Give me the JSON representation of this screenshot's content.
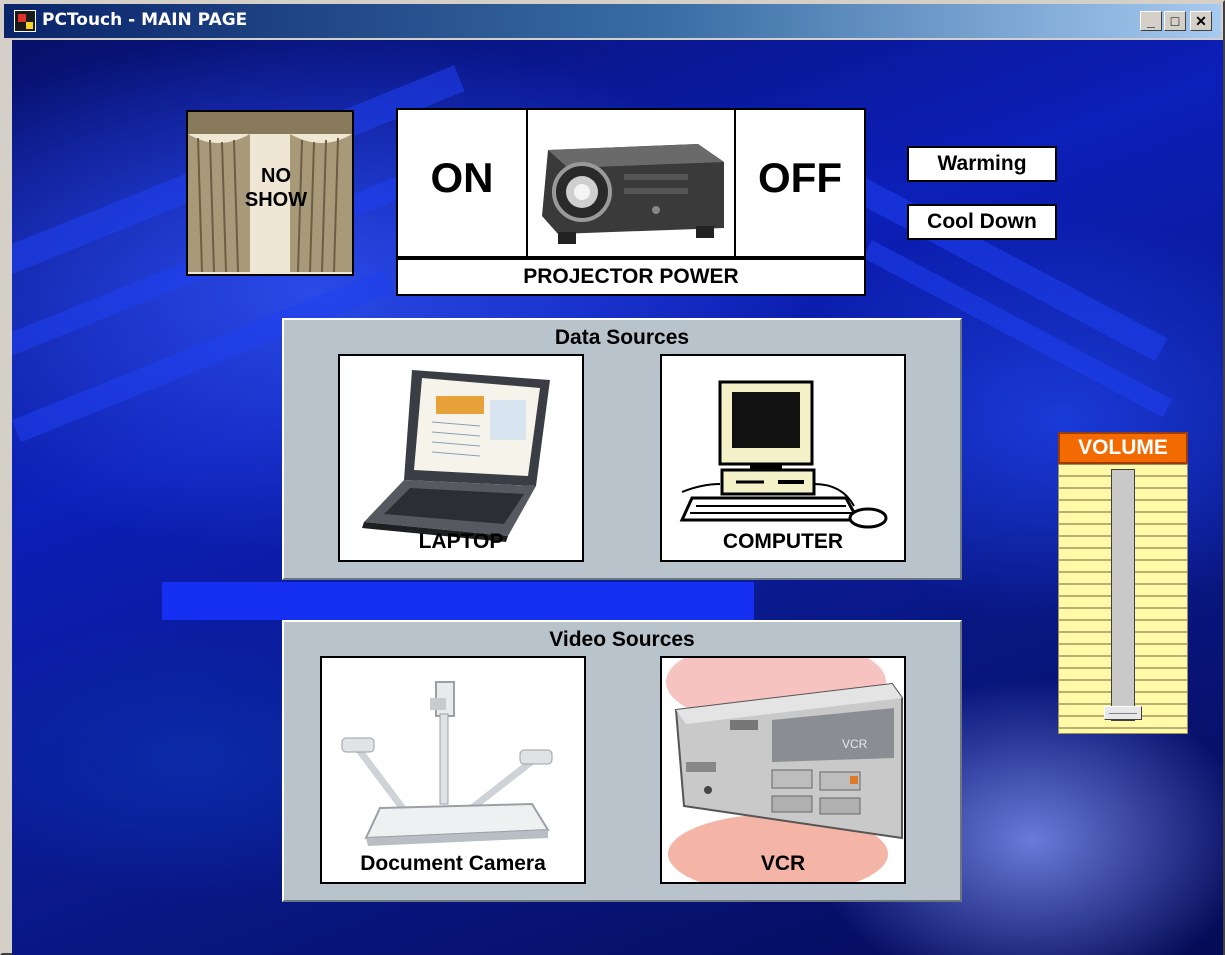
{
  "window": {
    "title": "PCTouch - MAIN PAGE",
    "controls": {
      "minimize": "_",
      "maximize": "□",
      "close": "✕"
    }
  },
  "projector": {
    "no_show_label": "NO SHOW",
    "on_label": "ON",
    "off_label": "OFF",
    "power_label": "PROJECTOR POWER",
    "status_warming": "Warming",
    "status_cooldown": "Cool Down"
  },
  "data_sources": {
    "title": "Data Sources",
    "items": [
      "LAPTOP",
      "COMPUTER"
    ]
  },
  "video_sources": {
    "title": "Video Sources",
    "items": [
      "Document Camera",
      "VCR"
    ],
    "vcr_device_text": "VCR"
  },
  "volume": {
    "label": "VOLUME",
    "level": 0.0
  },
  "colors": {
    "title_bar": "#0a246a",
    "panel": "#b8c3cb",
    "volume_header": "#f26a00",
    "volume_body": "#fff9a8",
    "background_blue": "#0c1fb8"
  }
}
